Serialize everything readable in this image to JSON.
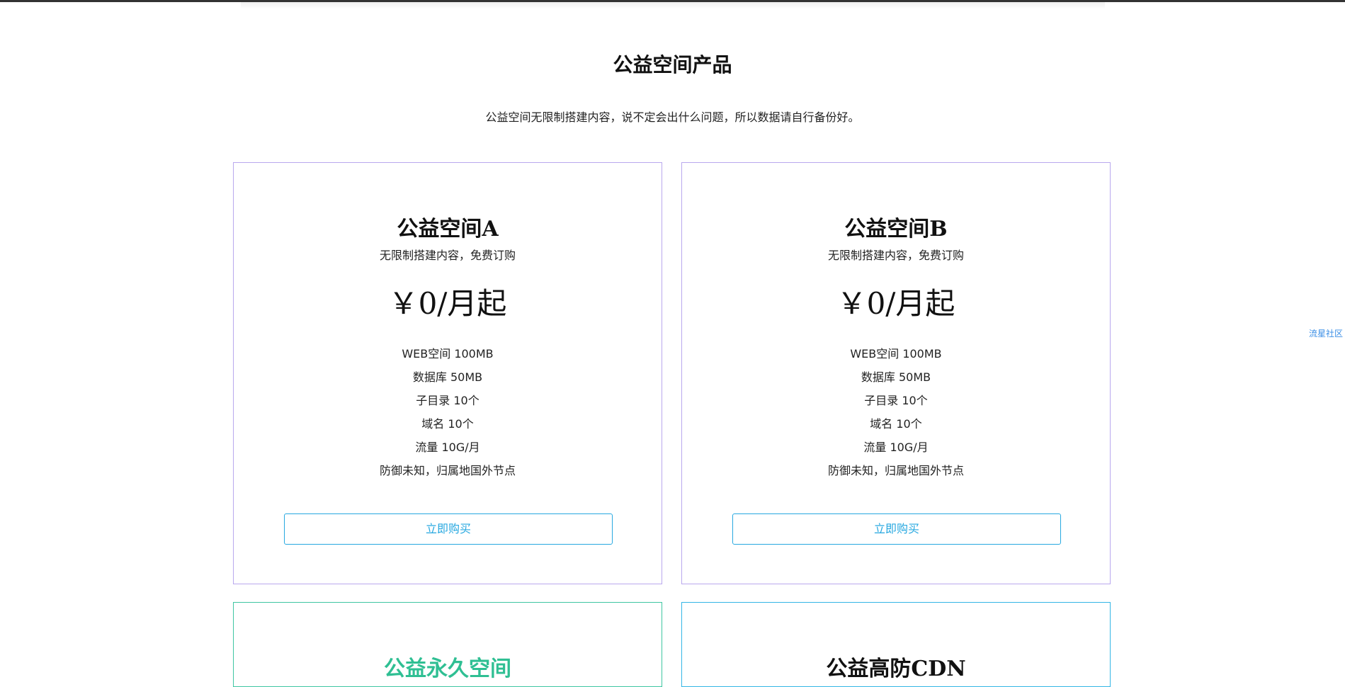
{
  "header": {
    "title": "公益空间产品",
    "subtitle": "公益空间无限制搭建内容，说不定会出什么问题，所以数据请自行备份好。"
  },
  "side_link": {
    "label": "流星社区"
  },
  "colors": {
    "card_border_purple": "#b9a8ee",
    "card_border_green": "#3fc6a2",
    "card_border_blue": "#33b6e6",
    "button_accent": "#27a8e0",
    "link": "#3a8ee6"
  },
  "products": [
    {
      "title": "公益空间A",
      "description": "无限制搭建内容，免费订购",
      "price": "￥0/月起",
      "features": [
        "WEB空间 100MB",
        "数据库 50MB",
        "子目录 10个",
        "域名 10个",
        "流量 10G/月",
        "防御未知，归属地国外节点"
      ],
      "button_label": "立即购买"
    },
    {
      "title": "公益空间B",
      "description": "无限制搭建内容，免费订购",
      "price": "￥0/月起",
      "features": [
        "WEB空间 100MB",
        "数据库 50MB",
        "子目录 10个",
        "域名 10个",
        "流量 10G/月",
        "防御未知，归属地国外节点"
      ],
      "button_label": "立即购买"
    },
    {
      "title": "公益永久空间"
    },
    {
      "title": "公益高防CDN"
    }
  ]
}
